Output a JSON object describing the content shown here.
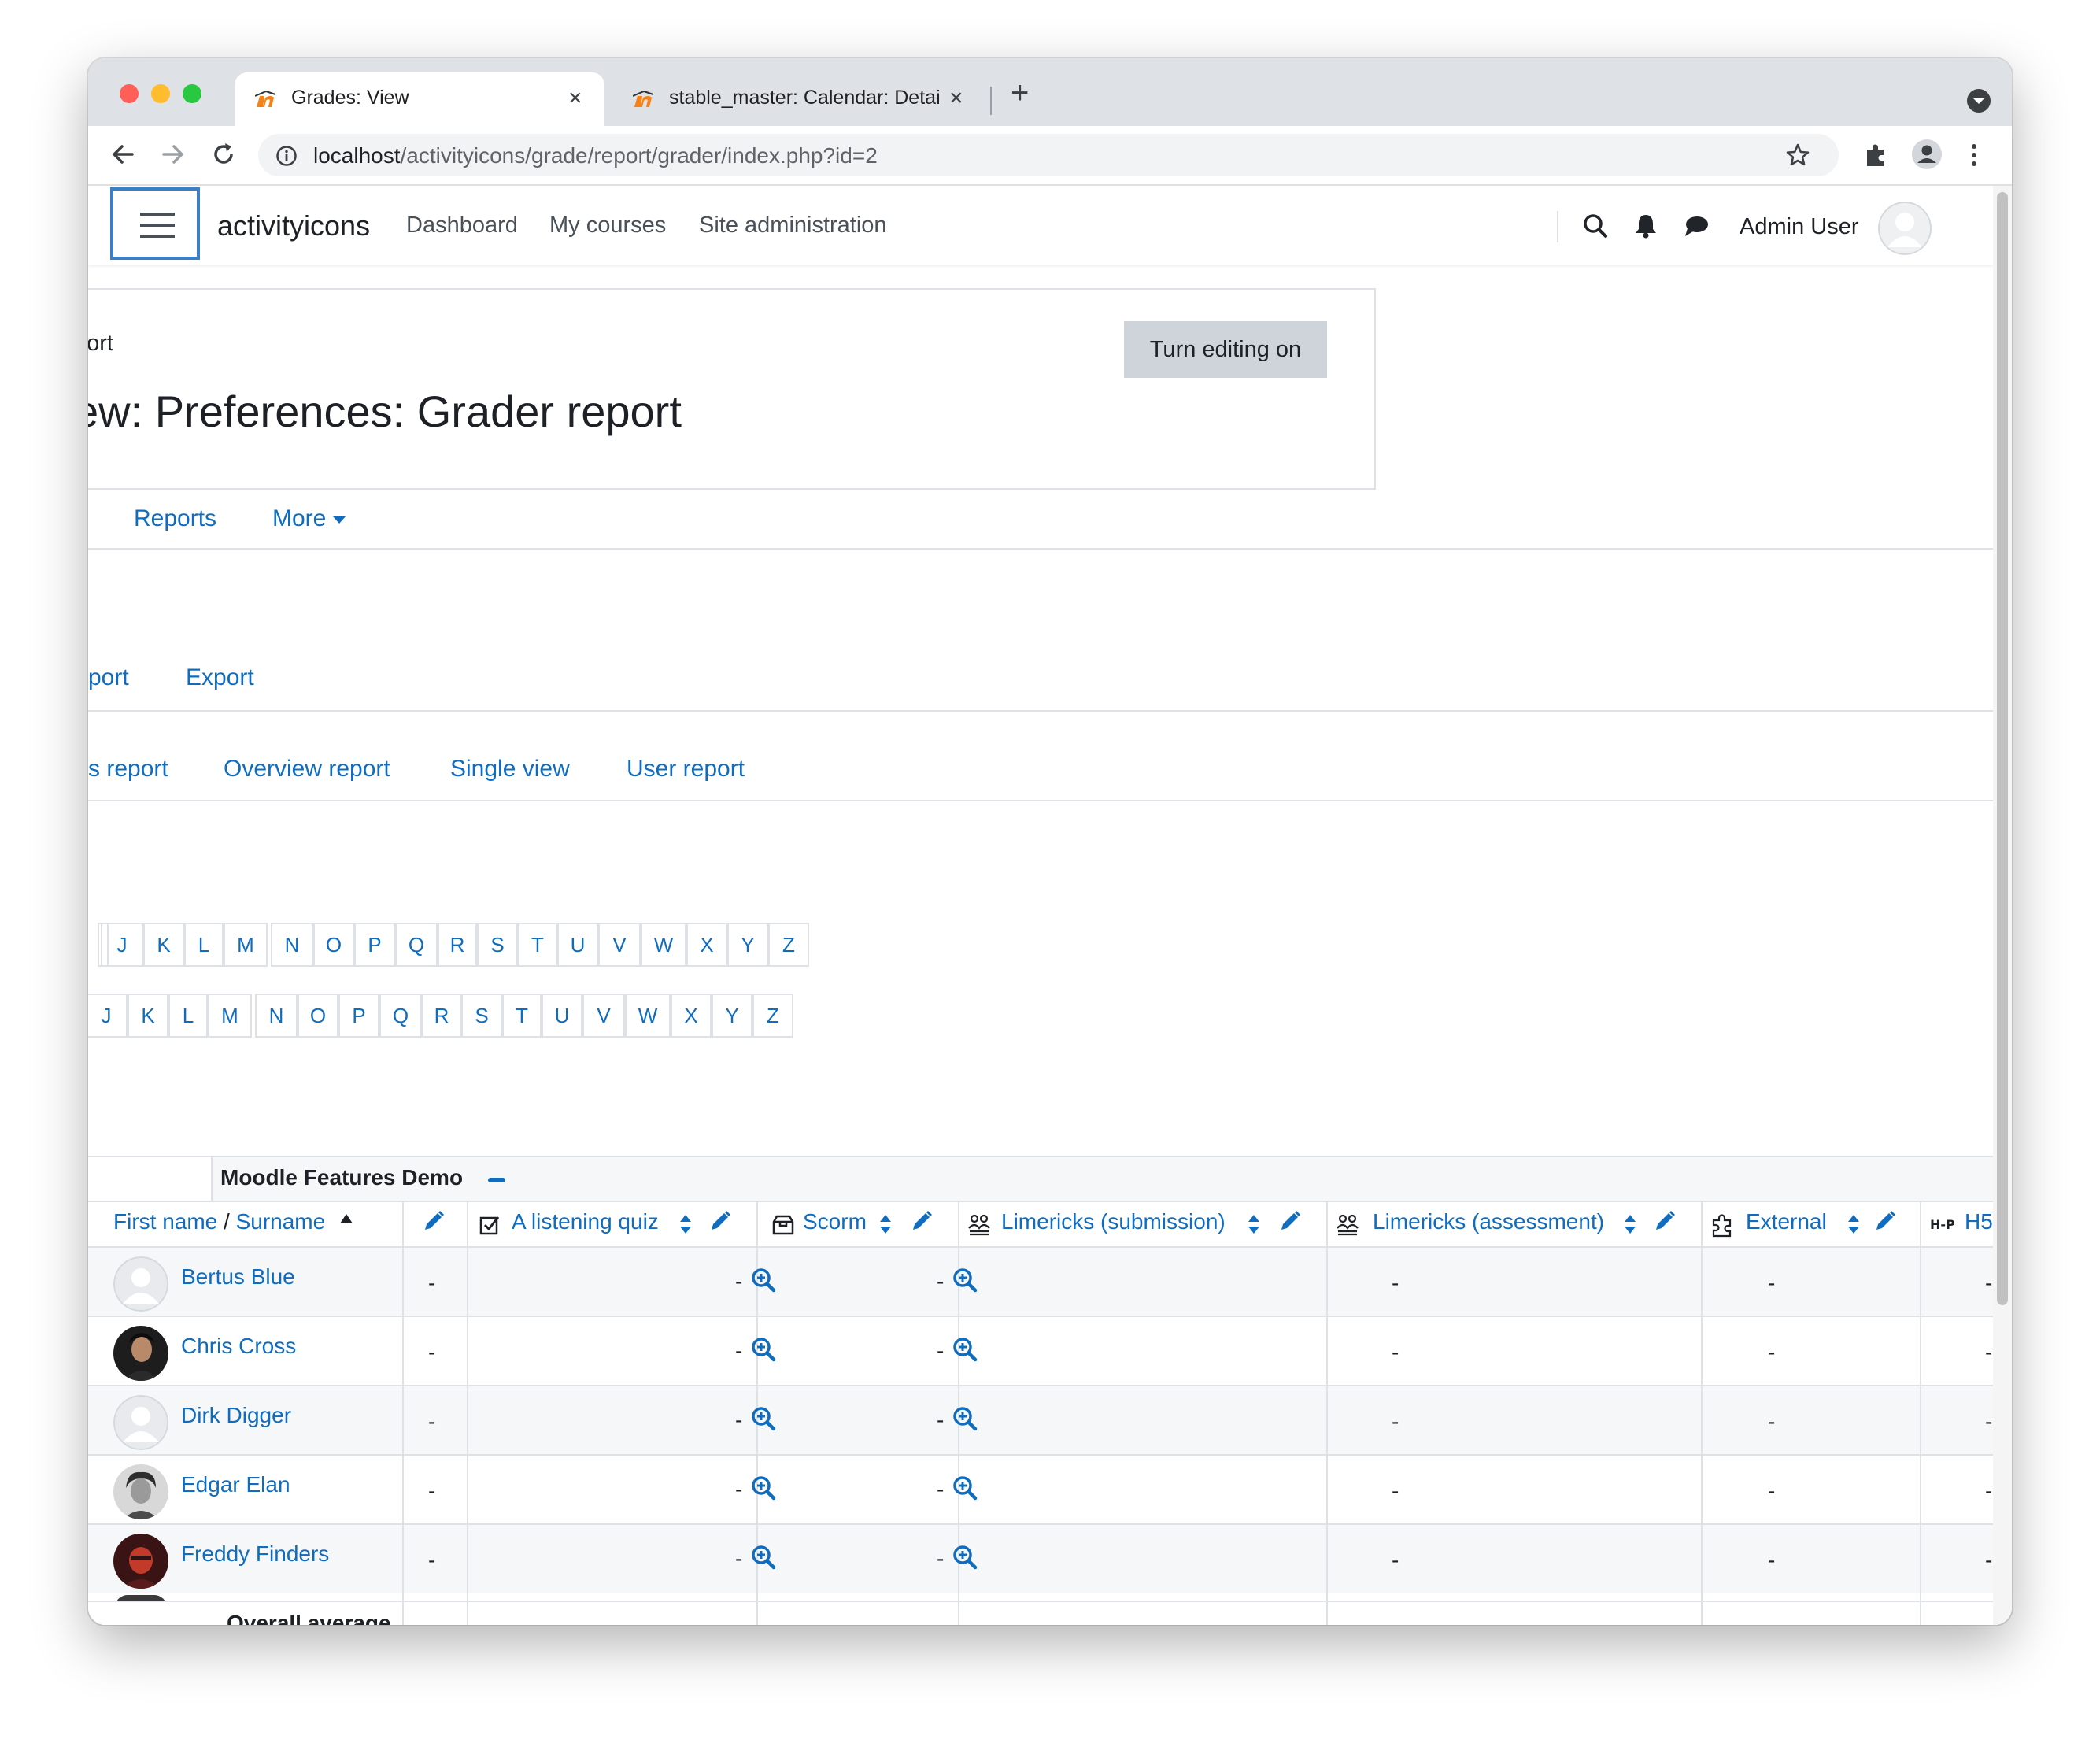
{
  "browser": {
    "tabs": [
      {
        "title": "Grades: View",
        "close": "×"
      },
      {
        "title": "stable_master: Calendar: Detai",
        "close": "×"
      }
    ],
    "new_tab": "+",
    "url_host": "localhost",
    "url_path": "/activityicons/grade/report/grader/index.php?id=2",
    "traffic_colors": [
      "#ff5f57",
      "#febc2e",
      "#28c840"
    ]
  },
  "topnav": {
    "brand": "activityicons",
    "links": [
      "Dashboard",
      "My courses",
      "Site administration"
    ],
    "user": "Admin User"
  },
  "header": {
    "breadcrumb": "port",
    "title": "ew: Preferences: Grader report",
    "edit_button": "Turn editing on"
  },
  "secondary_nav": {
    "reports": "Reports",
    "more": "More"
  },
  "action_tabs": [
    "port",
    "Export"
  ],
  "report_tabs": [
    "s report",
    "Overview report",
    "Single view",
    "User report"
  ],
  "initials_first": [
    "J",
    "K",
    "L",
    "M",
    "N",
    "O",
    "P",
    "Q",
    "R",
    "S",
    "T",
    "U",
    "V",
    "W",
    "X",
    "Y",
    "Z"
  ],
  "initials_last": [
    "J",
    "K",
    "L",
    "M",
    "N",
    "O",
    "P",
    "Q",
    "R",
    "S",
    "T",
    "U",
    "V",
    "W",
    "X",
    "Y",
    "Z"
  ],
  "table": {
    "category": "Moodle Features Demo",
    "name_header_first": "First name",
    "name_header_sep": " / ",
    "name_header_last": "Surname",
    "columns": [
      {
        "label": "A listening quiz",
        "icon": "quiz-icon"
      },
      {
        "label": "Scorm",
        "icon": "scorm-icon"
      },
      {
        "label": "Limericks (submission)",
        "icon": "workshop-icon"
      },
      {
        "label": "Limericks (assessment)",
        "icon": "workshop-icon"
      },
      {
        "label": "External",
        "icon": "lti-icon"
      },
      {
        "label": "H5",
        "icon": "h5p-icon"
      }
    ],
    "h5p_badge": "H-P",
    "rows": [
      {
        "name": "Bertus Blue"
      },
      {
        "name": "Chris Cross"
      },
      {
        "name": "Dirk Digger"
      },
      {
        "name": "Edgar Elan"
      },
      {
        "name": "Freddy Finders"
      }
    ],
    "empty_value": "-",
    "overall_label": "Overall average"
  },
  "accent_color": "#0f6cbf"
}
